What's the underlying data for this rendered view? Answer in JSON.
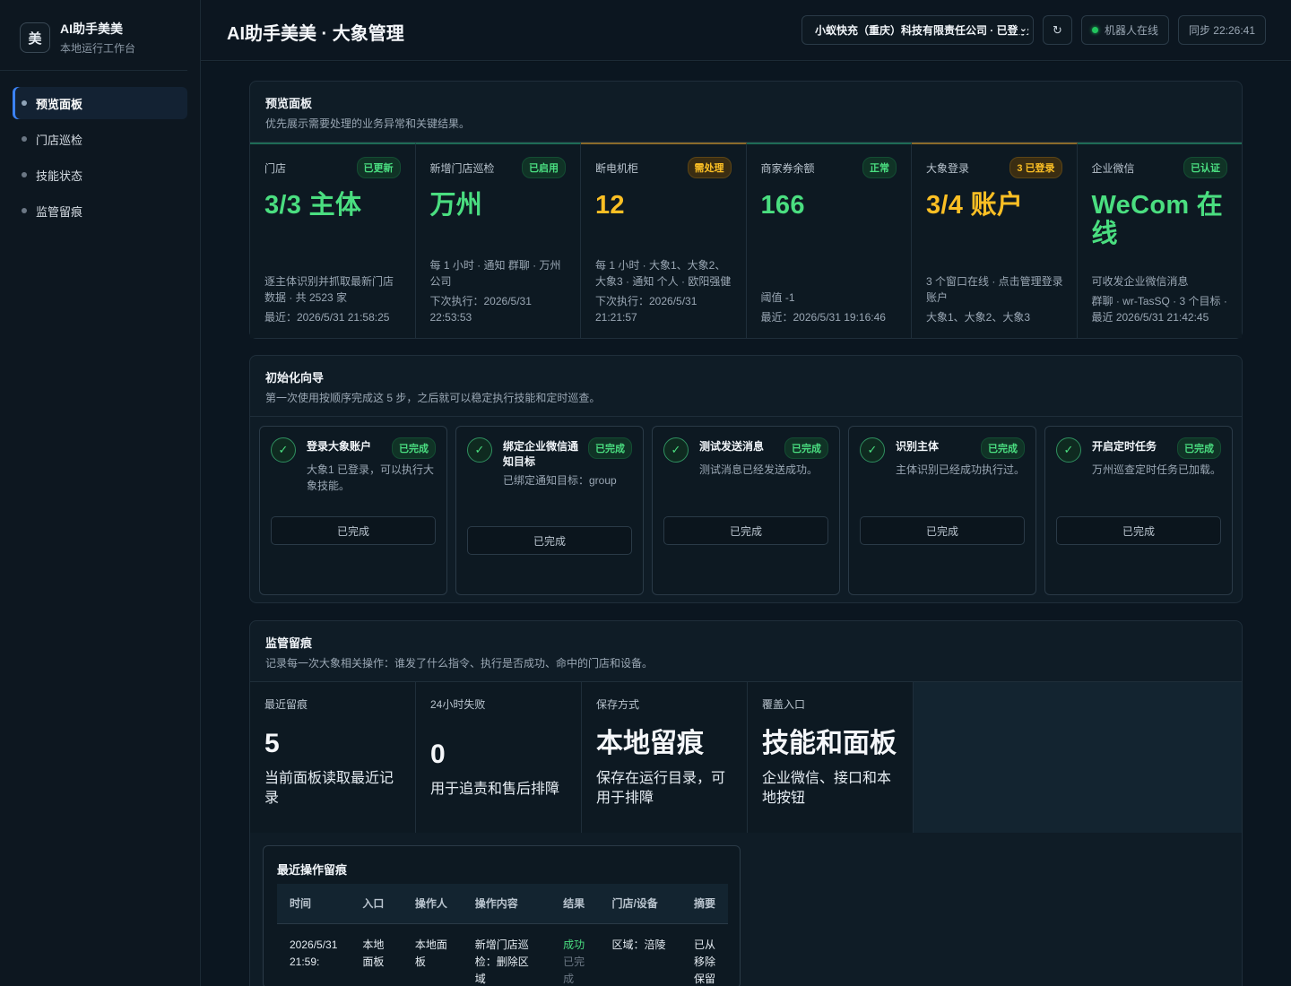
{
  "brand": {
    "logo": "美",
    "title": "AI助手美美",
    "subtitle": "本地运行工作台"
  },
  "nav": {
    "items": [
      {
        "label": "预览面板",
        "active": true
      },
      {
        "label": "门店巡检"
      },
      {
        "label": "技能状态"
      },
      {
        "label": "监管留痕"
      }
    ]
  },
  "header": {
    "title": "AI助手美美 · 大象管理",
    "company_select": "小蚁快充（重庆）科技有限责任公司 · 已登录",
    "refresh_icon": "refresh-icon",
    "robot_status": "机器人在线",
    "sync": "同步 22:26:41"
  },
  "overview": {
    "title": "预览面板",
    "desc": "优先展示需要处理的业务异常和关键结果。",
    "cards": [
      {
        "label": "门店",
        "badge": "已更新",
        "value": "3/3 主体",
        "desc": "",
        "foot1": "逐主体识别并抓取最新门店数据 · 共 2523 家",
        "foot2": "最近：2026/5/31 21:58:25"
      },
      {
        "label": "新增门店巡检",
        "badge": "已启用",
        "value": "万州",
        "desc": "",
        "foot1": "每 1 小时 · 通知 群聊 · 万州公司",
        "foot2": "下次执行：2026/5/31 22:53:53"
      },
      {
        "label": "断电机柜",
        "badge": "需处理",
        "value": "12",
        "desc": "",
        "foot1": "每 1 小时 · 大象1、大象2、大象3 · 通知 个人 · 欧阳强健",
        "foot2": "下次执行：2026/5/31 21:21:57"
      },
      {
        "label": "商家券余额",
        "badge": "正常",
        "value": "166",
        "desc": "",
        "foot1": "阈值 -1",
        "foot2": "最近：2026/5/31 19:16:46"
      },
      {
        "label": "大象登录",
        "badge": "3 已登录",
        "value": "3/4 账户",
        "desc": "",
        "foot1": "3 个窗口在线 · 点击管理登录账户",
        "foot2": "大象1、大象2、大象3"
      },
      {
        "label": "企业微信",
        "badge": "已认证",
        "value": "WeCom 在线",
        "desc": "",
        "foot1": "可收发企业微信消息",
        "foot2": "群聊 · wr-TasSQ · 3 个目标 · 最近 2026/5/31 21:42:45"
      }
    ]
  },
  "wizard": {
    "title": "初始化向导",
    "desc": "第一次使用按顺序完成这 5 步，之后就可以稳定执行技能和定时巡查。",
    "steps": [
      {
        "title": "登录大象账户",
        "badge": "已完成",
        "desc": "大象1 已登录，可以执行大象技能。",
        "button": "已完成"
      },
      {
        "title": "绑定企业微信通知目标",
        "badge": "已完成",
        "desc": "已绑定通知目标：group",
        "button": "已完成"
      },
      {
        "title": "测试发送消息",
        "badge": "已完成",
        "desc": "测试消息已经发送成功。",
        "button": "已完成"
      },
      {
        "title": "识别主体",
        "badge": "已完成",
        "desc": "主体识别已经成功执行过。",
        "button": "已完成"
      },
      {
        "title": "开启定时任务",
        "badge": "已完成",
        "desc": "万州巡查定时任务已加载。",
        "button": "已完成"
      }
    ]
  },
  "audit": {
    "title": "监管留痕",
    "desc": "记录每一次大象相关操作：谁发了什么指令、执行是否成功、命中的门店和设备。",
    "stats": [
      {
        "label": "最近留痕",
        "value": "5",
        "desc": "当前面板读取最近记录"
      },
      {
        "label": "24小时失败",
        "value": "0",
        "desc": "用于追责和售后排障"
      },
      {
        "label": "保存方式",
        "value": "本地留痕",
        "desc": "保存在运行目录，可用于排障"
      },
      {
        "label": "覆盖入口",
        "value": "技能和面板",
        "desc": "企业微信、接口和本地按钮"
      }
    ],
    "log": {
      "title": "最近操作留痕",
      "columns": [
        "时间",
        "入口",
        "操作人",
        "操作内容",
        "结果",
        "门店/设备",
        "摘要"
      ],
      "rows": [
        {
          "time": "2026/5/31 21:59:",
          "entry": "本地面板",
          "operator": "本地面板",
          "content": "新增门店巡检：删除区域",
          "result": "成功",
          "result_sub": "已完成",
          "store": "区域：涪陵",
          "summary": "已从移除保留"
        }
      ]
    }
  }
}
